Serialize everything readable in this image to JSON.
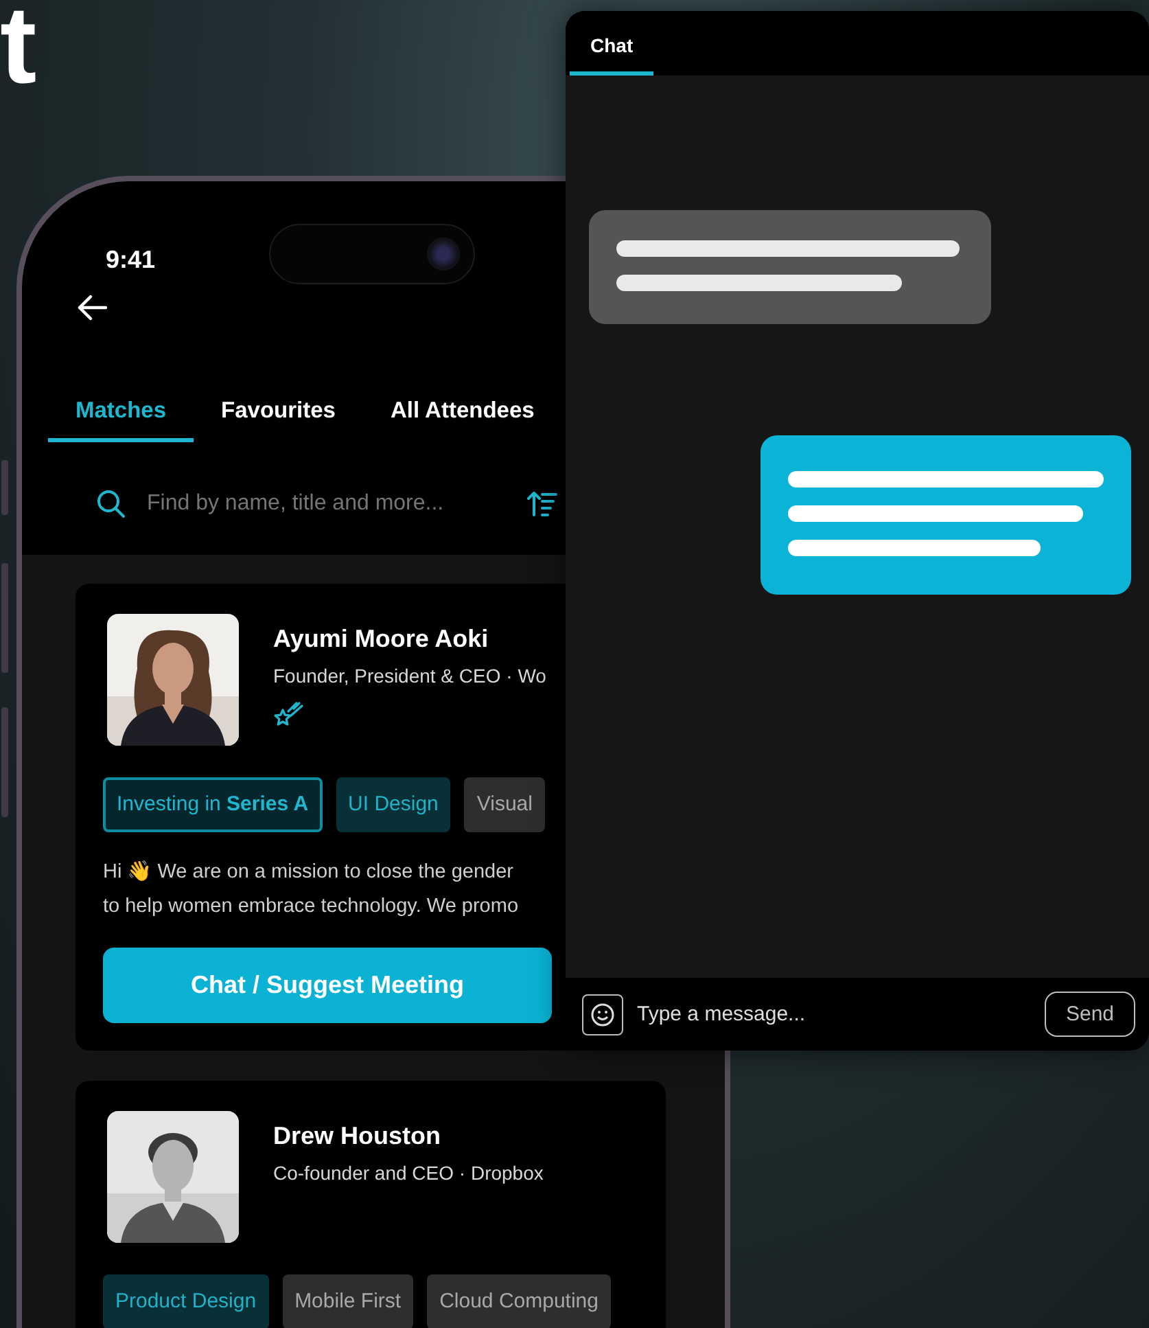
{
  "heading": {
    "text": "t"
  },
  "phone": {
    "status_time": "9:41",
    "tabs": [
      {
        "label": "Matches",
        "selected": true
      },
      {
        "label": "Favourites",
        "selected": false
      },
      {
        "label": "All Attendees",
        "selected": false
      }
    ],
    "search": {
      "placeholder": "Find by name, title and more..."
    },
    "profiles": [
      {
        "photo": {
          "kind": "picture"
        },
        "name": "Ayumi Moore Aoki",
        "headline": "Founder, President & CEO · Wo",
        "featured": true,
        "tags": [
          {
            "label": "Investing in **Series A**",
            "kind": "outlined"
          },
          {
            "label": "UI Design",
            "kind": "filled"
          },
          {
            "label": "Visual",
            "kind": "plain"
          }
        ],
        "bio": [
          "Hi 👋  We are on a mission to close the gender",
          "to help women embrace technology. We promo"
        ],
        "action": "Chat / Suggest Meeting"
      },
      {
        "photo": {
          "kind": "picture"
        },
        "name": "Drew Houston",
        "headline": "Co-founder and CEO · Dropbox",
        "featured": false,
        "tags": [
          {
            "label": "Product Design",
            "kind": "filled"
          },
          {
            "label": "Mobile First",
            "kind": "plain"
          },
          {
            "label": "Cloud Computing",
            "kind": "plain"
          }
        ]
      }
    ]
  },
  "chat": {
    "tabs": [
      {
        "label": "Chat",
        "selected": true
      }
    ],
    "messages": [
      {
        "kind": "received"
      },
      {
        "kind": "sent"
      }
    ],
    "composer": {
      "placeholder": "Type a message..."
    },
    "send_button": "Send"
  }
}
